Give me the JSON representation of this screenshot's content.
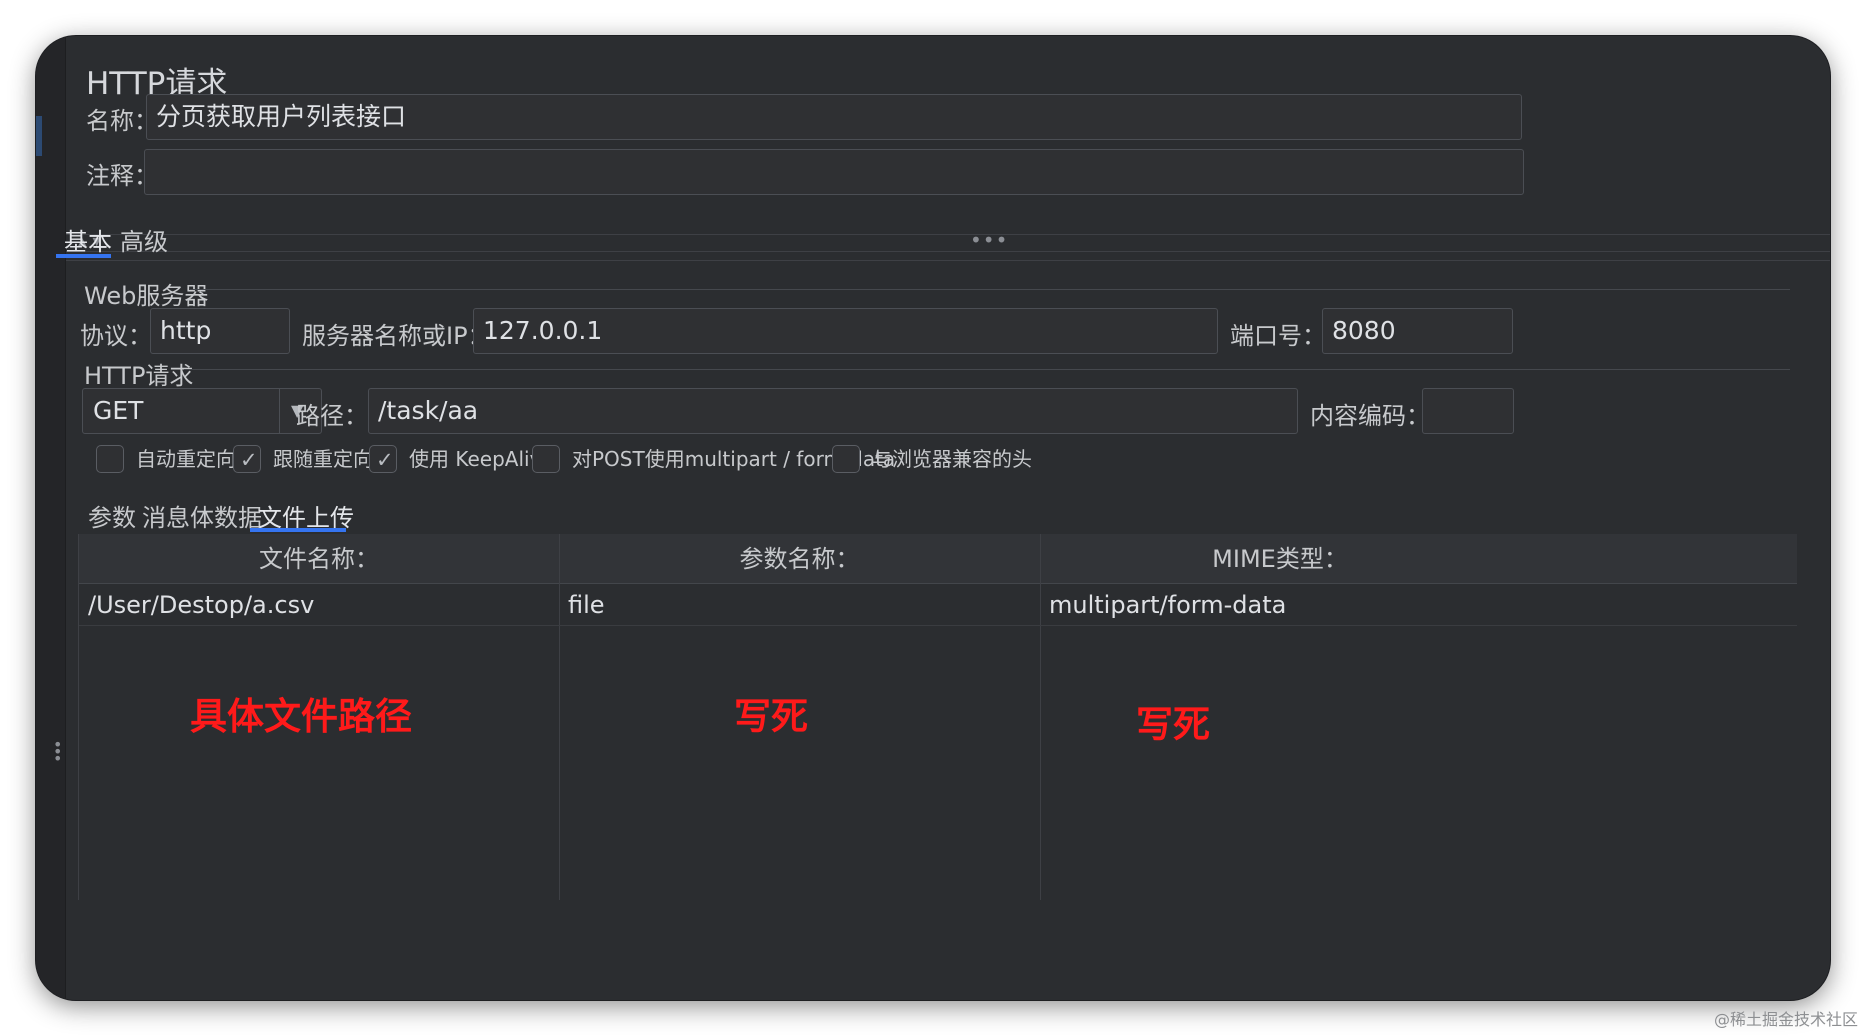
{
  "title": "HTTP请求",
  "name_label": "名称：",
  "name_value": "分页获取用户列表接口",
  "comment_label": "注释：",
  "comment_value": "",
  "tabs": [
    {
      "label": "基本",
      "active": true
    },
    {
      "label": "高级",
      "active": false
    }
  ],
  "web_server": {
    "group_title": "Web服务器",
    "protocol_label": "协议：",
    "protocol_value": "http",
    "server_label": "服务器名称或IP：",
    "server_value": "127.0.0.1",
    "port_label": "端口号：",
    "port_value": "8080"
  },
  "http_request": {
    "group_title": "HTTP请求",
    "method": "GET",
    "path_label": "路径：",
    "path_value": "/task/aa",
    "encoding_label": "内容编码：",
    "encoding_value": ""
  },
  "checkboxes": [
    {
      "label": "自动重定向",
      "checked": false
    },
    {
      "label": "跟随重定向",
      "checked": true
    },
    {
      "label": "使用 KeepAlive",
      "checked": true
    },
    {
      "label": "对POST使用multipart / form-data",
      "checked": false
    },
    {
      "label": "与浏览器兼容的头",
      "checked": false
    }
  ],
  "sub_tabs": [
    {
      "label": "参数",
      "active": false
    },
    {
      "label": "消息体数据",
      "active": false
    },
    {
      "label": "文件上传",
      "active": true
    }
  ],
  "table": {
    "headers": [
      "文件名称：",
      "参数名称：",
      "MIME类型："
    ],
    "rows": [
      [
        "/User/Destop/a.csv",
        "file",
        "multipart/form-data"
      ]
    ]
  },
  "annotations": [
    "具体文件路径",
    "写死",
    "写死"
  ],
  "watermark": "@稀土掘金技术社区",
  "colors": {
    "background": "#2b2d30",
    "accent": "#3574f0",
    "annotation": "#ff1a1a"
  }
}
